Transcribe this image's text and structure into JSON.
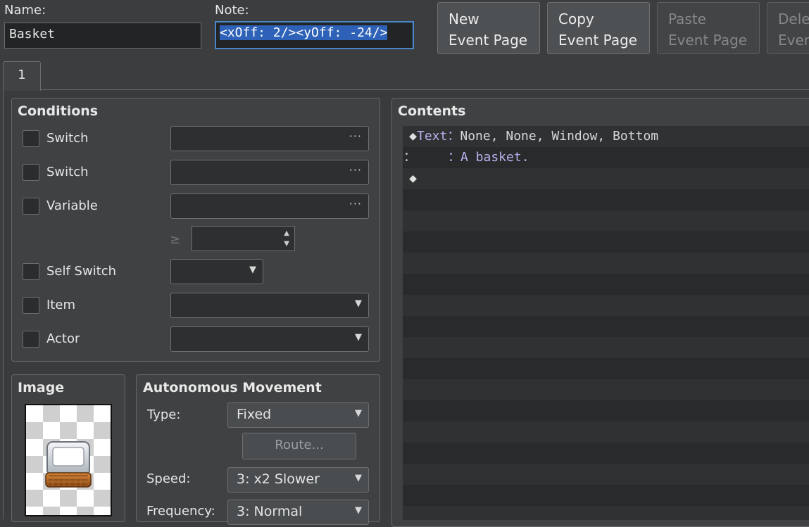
{
  "header": {
    "name_label": "Name:",
    "name_value": "Basket",
    "note_label": "Note:",
    "note_value": "<xOff: 2/><yOff: -24/>"
  },
  "toolbar": {
    "new_page": "New\nEvent Page",
    "copy_page": "Copy\nEvent Page",
    "paste_page": "Paste\nEvent Page",
    "delete_page": "Delete\nEvent Page"
  },
  "tabs": [
    {
      "label": "1"
    }
  ],
  "conditions": {
    "title": "Conditions",
    "switch1_label": "Switch",
    "switch2_label": "Switch",
    "variable_label": "Variable",
    "gte_symbol": "≥",
    "self_switch_label": "Self Switch",
    "item_label": "Item",
    "actor_label": "Actor",
    "ellipsis": "···"
  },
  "image": {
    "title": "Image"
  },
  "movement": {
    "title": "Autonomous Movement",
    "type_label": "Type:",
    "type_value": "Fixed",
    "route_label": "Route...",
    "speed_label": "Speed:",
    "speed_value": "3: x2 Slower",
    "frequency_label": "Frequency:",
    "frequency_value": "3: Normal"
  },
  "contents": {
    "title": "Contents",
    "rows": [
      {
        "marker": "◆",
        "command": "Text",
        "sep": "：",
        "args": "None, None, Window, Bottom"
      },
      {
        "marker": "：",
        "command": "",
        "sep": "：",
        "args": "A basket."
      },
      {
        "marker": "◆",
        "command": "",
        "sep": "",
        "args": ""
      }
    ]
  },
  "icons": {
    "arrow_down": "▼",
    "spin_up": "▲",
    "spin_down": "▼"
  }
}
